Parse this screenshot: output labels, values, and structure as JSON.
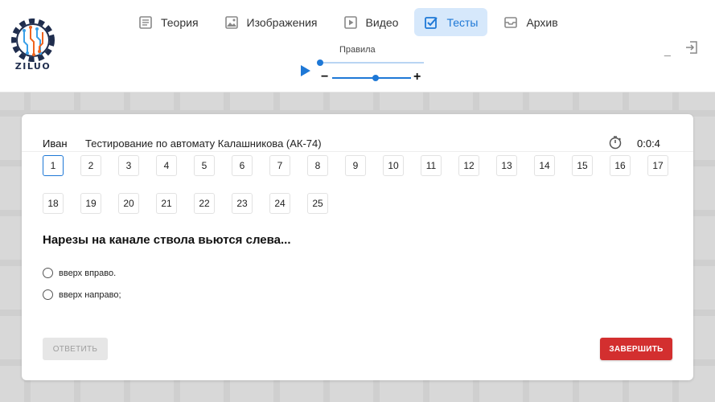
{
  "brand": {
    "name": "ZILUO",
    "logo_icon": "circuit-gear-icon",
    "colors": {
      "navy": "#1f2d4d",
      "orange": "#f0641e",
      "blue": "#3aa0e8"
    }
  },
  "nav": {
    "items": [
      {
        "label": "Теория",
        "icon": "book-icon",
        "active": false
      },
      {
        "label": "Изображения",
        "icon": "image-icon",
        "active": false
      },
      {
        "label": "Видео",
        "icon": "video-icon",
        "active": false
      },
      {
        "label": "Тесты",
        "icon": "test-check-icon",
        "active": true
      },
      {
        "label": "Архив",
        "icon": "archive-icon",
        "active": false
      }
    ]
  },
  "player": {
    "label": "Правила",
    "progress": 0.0,
    "volume": 0.55,
    "minus": "−",
    "plus": "+"
  },
  "window": {
    "minimize": "_"
  },
  "test": {
    "user": "Иван",
    "title": "Тестирование по автомату Калашникова (АК-74)",
    "timer": "0:0:4",
    "current_question": 1,
    "questions": [
      "1",
      "2",
      "3",
      "4",
      "5",
      "6",
      "7",
      "8",
      "9",
      "10",
      "11",
      "12",
      "13",
      "14",
      "15",
      "16",
      "17",
      "18",
      "19",
      "20",
      "21",
      "22",
      "23",
      "24",
      "25"
    ],
    "question_text": "Нарезы на канале ствола вьются слева...",
    "options": [
      "вверх вправо.",
      "вверх направо;"
    ],
    "answer_label": "ОТВЕТИТЬ",
    "finish_label": "ЗАВЕРШИТЬ"
  },
  "theme": {
    "accent": "#1e78d6",
    "active_tab_bg": "#d6e8fb",
    "finish": "#d32f2f",
    "disabled": "#e6e6e6"
  }
}
